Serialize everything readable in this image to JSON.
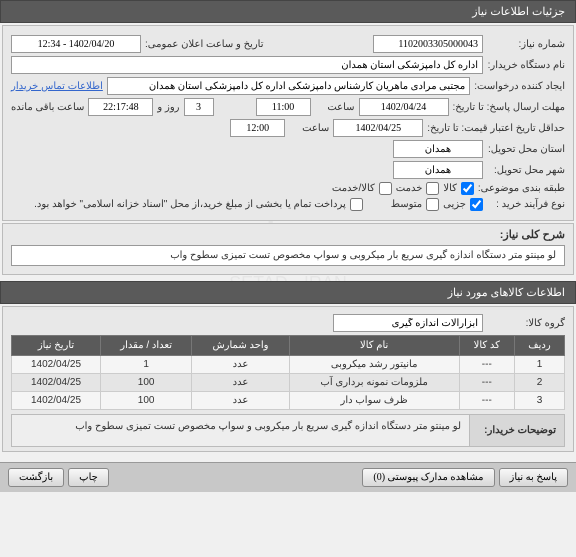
{
  "header": {
    "title": "جزئیات اطلاعات نیاز"
  },
  "fields": {
    "need_number_label": "شماره نیاز:",
    "need_number": "1102003305000043",
    "announce_label": "تاریخ و ساعت اعلان عمومی:",
    "announce_value": "1402/04/20 - 12:34",
    "buyer_org_label": "نام دستگاه خریدار:",
    "buyer_org": "اداره کل دامپزشکی استان همدان",
    "creator_label": "ایجاد کننده درخواست:",
    "creator": "مجتبی مرادی ماهریان کارشناس دامپزشکی اداره کل دامپزشکی استان همدان",
    "contact_link": "اطلاعات تماس خریدار",
    "deadline_label": "مهلت ارسال پاسخ: تا تاریخ:",
    "deadline_date": "1402/04/24",
    "time_label": "ساعت",
    "deadline_time": "11:00",
    "days_count": "3",
    "days_label": "روز و",
    "remain_time": "22:17:48",
    "remain_label": "ساعت باقی مانده",
    "validity_label": "حداقل تاریخ اعتبار قیمت: تا تاریخ:",
    "validity_date": "1402/04/25",
    "validity_time": "12:00",
    "need_loc_label": "استان محل تحویل:",
    "need_city": "همدان",
    "deliver_loc_label": "شهر محل تحویل:",
    "deliver_city": "همدان",
    "category_label": "طبقه بندی موضوعی:",
    "cat_goods": "کالا",
    "cat_service": "خدمت",
    "cat_both": "کالا/خدمت",
    "purchase_label": "نوع فرآیند خرید :",
    "purchase_opt1": "جزیی",
    "purchase_opt2": "متوسط",
    "payment_note": "پرداخت تمام یا بخشی از مبلغ خرید،از محل \"اسناد خزانه اسلامی\" خواهد بود."
  },
  "desc": {
    "label": "شرح کلی نیاز:",
    "text": "لو مینتو متر دستگاه اندازه گیری سریع بار میکروبی و سواپ مخصوص تست تمیزی سطوح واب"
  },
  "goods": {
    "header": "اطلاعات کالاهای مورد نیاز",
    "group_label": "گروه کالا:",
    "group_value": "ابزارآلات اندازه گیری"
  },
  "table": {
    "headers": [
      "ردیف",
      "کد کالا",
      "نام کالا",
      "واحد شمارش",
      "تعداد / مقدار",
      "تاریخ نیاز"
    ],
    "rows": [
      [
        "1",
        "---",
        "مانیتور رشد میکروبی",
        "عدد",
        "1",
        "1402/04/25"
      ],
      [
        "2",
        "---",
        "ملزومات نمونه برداری آب",
        "عدد",
        "100",
        "1402/04/25"
      ],
      [
        "3",
        "---",
        "ظرف سواب دار",
        "عدد",
        "100",
        "1402/04/25"
      ]
    ]
  },
  "buyer_notes": {
    "label": "توضیحات خریدار:",
    "text": "لو مینتو متر دستگاه اندازه گیری سریع بار میکروبی و سواپ مخصوص تست تمیزی سطوح واب"
  },
  "footer": {
    "respond": "پاسخ به نیاز",
    "attachments": "مشاهده مدارک پیوستی  (0)",
    "print": "چاپ",
    "back": "بازگشت"
  },
  "watermark": {
    "line1": "ستاد",
    "line2": "SETAD - IRAN",
    "line3": "۰۲۱-۸۸۳۴۹۰۰۰"
  }
}
